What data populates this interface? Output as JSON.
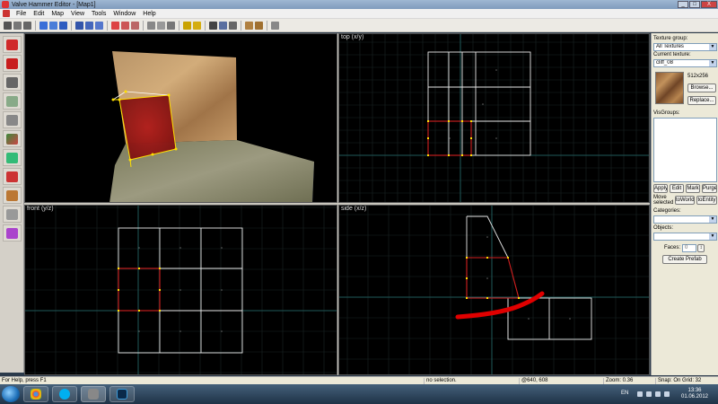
{
  "window": {
    "title": "Valve Hammer Editor - [Map1]",
    "controls": [
      "_",
      "□",
      "X"
    ]
  },
  "menu": {
    "items": [
      "File",
      "Edit",
      "Map",
      "View",
      "Tools",
      "Window",
      "Help"
    ]
  },
  "viewports": {
    "top_label": "top (x/y)",
    "front_label": "front (y/z)",
    "side_label": "side (x/z)"
  },
  "texture_panel": {
    "group_label": "Texture group:",
    "group_value": "All Textures",
    "current_label": "Current texture:",
    "current_value": "cliff_08",
    "size": "512x256",
    "browse_label": "Browse...",
    "replace_label": "Replace...",
    "visgroups_label": "VisGroups:",
    "apply_label": "Apply",
    "edit_label": "Edit",
    "mark_label": "Mark",
    "purge_label": "Purge",
    "move_selected_label": "Move selected",
    "to_world_label": "toWorld",
    "to_entity_label": "toEntity",
    "categories_label": "Categories:",
    "objects_label": "Objects:",
    "faces_label": "Faces:",
    "faces_value": "0",
    "create_prefab_label": "Create Prefab"
  },
  "statusbar": {
    "help": "For Help, press F1",
    "selection": "no selection.",
    "coords": "@640, 608",
    "zoom": "Zoom: 0.36",
    "snap": "Snap: On Grid: 32"
  },
  "taskbar": {
    "lang": "EN",
    "time": "13:36",
    "date": "01.06.2012"
  },
  "colors": {
    "grid": "#1d2a2a",
    "axis": "#1f5a5a",
    "brush_white": "#e8e8e8",
    "brush_selected": "#d42020",
    "vertex": "#ffe000",
    "annotation_stroke": "#e00000"
  }
}
